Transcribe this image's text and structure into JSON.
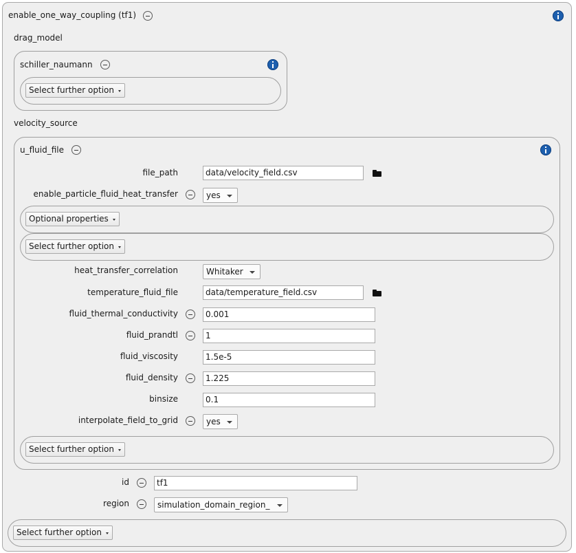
{
  "root": {
    "title": "enable_one_way_coupling (tf1)"
  },
  "drag_model": {
    "label": "drag_model",
    "option": "schiller_naumann",
    "select_further": "Select further option"
  },
  "velocity_source": {
    "label": "velocity_source",
    "option": "u_fluid_file",
    "file_path": {
      "label": "file_path",
      "value": "data/velocity_field.csv"
    },
    "heat_transfer": {
      "label": "enable_particle_fluid_heat_transfer",
      "value": "yes"
    },
    "optional_properties": "Optional properties",
    "select_further_1": "Select further option",
    "heat_transfer_correlation": {
      "label": "heat_transfer_correlation",
      "value": "Whitaker"
    },
    "temperature_fluid_file": {
      "label": "temperature_fluid_file",
      "value": "data/temperature_field.csv"
    },
    "fluid_thermal_conductivity": {
      "label": "fluid_thermal_conductivity",
      "value": "0.001"
    },
    "fluid_prandtl": {
      "label": "fluid_prandtl",
      "value": "1"
    },
    "fluid_viscosity": {
      "label": "fluid_viscosity",
      "value": "1.5e-5"
    },
    "fluid_density": {
      "label": "fluid_density",
      "value": "1.225"
    },
    "binsize": {
      "label": "binsize",
      "value": "0.1"
    },
    "interpolate_field_to_grid": {
      "label": "interpolate_field_to_grid",
      "value": "yes"
    },
    "select_further_2": "Select further option"
  },
  "id_field": {
    "label": "id",
    "value": "tf1"
  },
  "region_field": {
    "label": "region",
    "value": "simulation_domain_region_"
  },
  "select_further_root": "Select further option",
  "colors": {
    "info": "#1d5fae",
    "panel": "#efefef",
    "border": "#9f9f9f"
  },
  "icons": [
    "minus-circle-icon",
    "info-icon",
    "folder-icon",
    "dropdown-caret-icon"
  ]
}
